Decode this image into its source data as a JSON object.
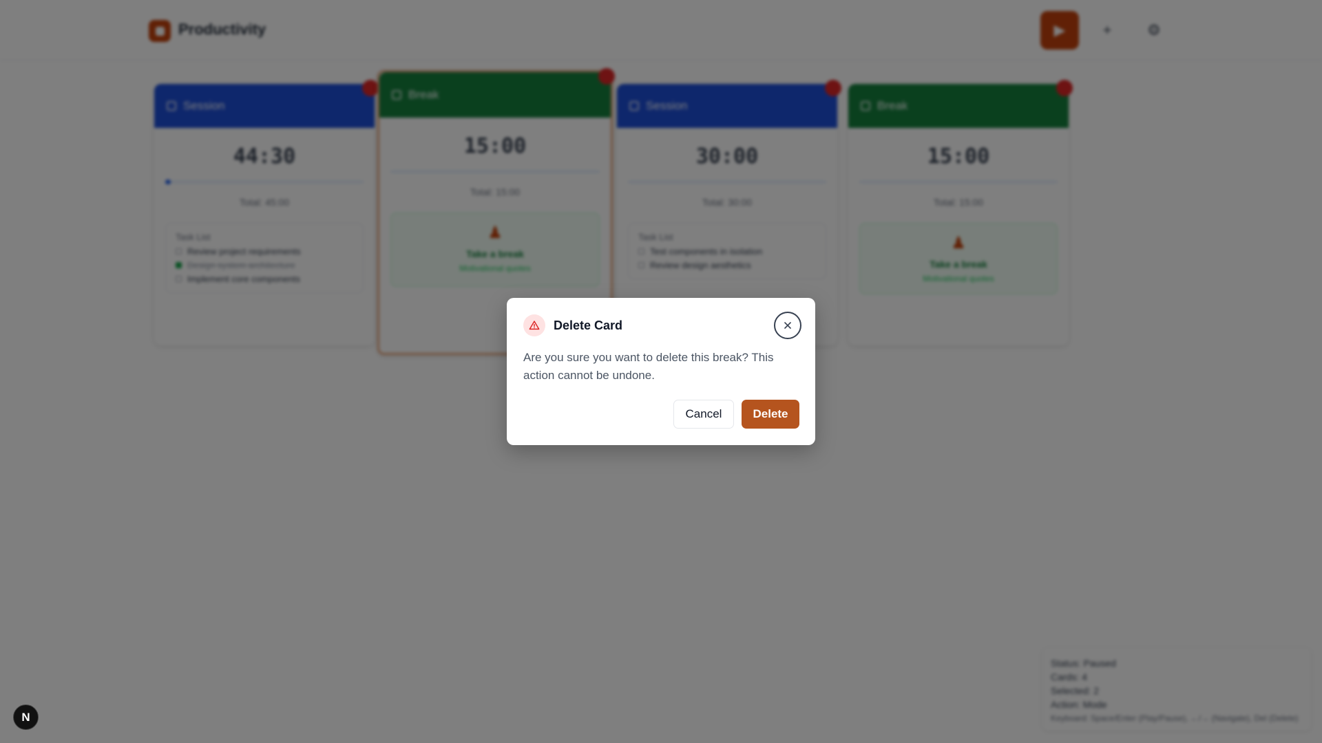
{
  "header": {
    "brand": "Productivity",
    "play_icon": "play-icon",
    "add_icon": "plus-icon",
    "settings_icon": "gear-icon"
  },
  "cards": [
    {
      "type": "session",
      "title": "Session",
      "time": "44:30",
      "total": "Total: 45:00",
      "progress": 0.02,
      "task_list_title": "Task List",
      "tasks": [
        {
          "label": "Review project requirements",
          "done": false
        },
        {
          "label": "Design system architecture",
          "done": true
        },
        {
          "label": "Implement core components",
          "done": false
        }
      ]
    },
    {
      "type": "break",
      "title": "Break",
      "time": "15:00",
      "total": "Total: 15:00",
      "progress": 0,
      "break_title": "Take a break",
      "break_sub": "Motivational quotes"
    },
    {
      "type": "session",
      "title": "Session",
      "time": "30:00",
      "total": "Total: 30:00",
      "progress": 0,
      "task_list_title": "Task List",
      "tasks": [
        {
          "label": "Test components in isolation",
          "done": false
        },
        {
          "label": "Review design aesthetics",
          "done": false
        }
      ]
    },
    {
      "type": "break",
      "title": "Break",
      "time": "15:00",
      "total": "Total: 15:00",
      "progress": 0,
      "break_title": "Take a break",
      "break_sub": "Motivational quotes"
    }
  ],
  "status": {
    "status": "Status: Paused",
    "cards": "Cards: 4",
    "selected": "Selected: 2",
    "action": "Action: Mode",
    "keyboard": "Keyboard: Space/Enter (Play/Pause), ←/→ (Navigate), Del (Delete)"
  },
  "dialog": {
    "title": "Delete Card",
    "message": "Are you sure you want to delete this break? This action cannot be undone.",
    "cancel_label": "Cancel",
    "delete_label": "Delete",
    "close_icon": "close-icon",
    "warning_icon": "warning-triangle-icon"
  },
  "dev_badge": "N",
  "colors": {
    "accent": "#c2410c",
    "delete_button": "#b5541e",
    "session": "#1d4ed8",
    "break": "#15803d",
    "danger": "#dc2626"
  }
}
